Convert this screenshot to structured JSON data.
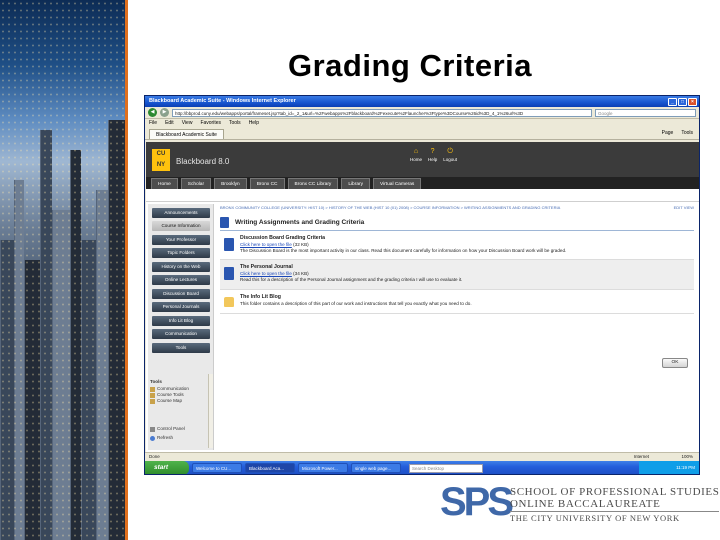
{
  "slide": {
    "title": "Grading Criteria",
    "accent_color": "#e0701e"
  },
  "browser": {
    "window_title": "Blackboard Academic Suite - Windows Internet Explorer",
    "url": "http://bbprod.cuny.edu/webapps/portal/frameset.jsp?tab_id=_2_1&url=%2Fwebapps%2Fblackboard%2Fexecute%2Flauncher%3Ftype%3DCourse%26id%3D_4_1%26url%3D",
    "search_placeholder": "Google",
    "menu": [
      "File",
      "Edit",
      "View",
      "Favorites",
      "Tools",
      "Help"
    ],
    "tab_label": "Blackboard Academic Suite",
    "toolbar_right": [
      "Page",
      "Tools"
    ],
    "status_left": "Done",
    "status_zone": "Internet",
    "status_zoom": "100%"
  },
  "bb": {
    "product": "Blackboard 8.0",
    "logo_text": "CU NY",
    "top_links": [
      {
        "label": "Home",
        "icon": "home-icon"
      },
      {
        "label": "Help",
        "icon": "help-icon"
      },
      {
        "label": "Logout",
        "icon": "logout-icon"
      }
    ],
    "tabs": [
      "Home",
      "Scholar",
      "Brooklyn",
      "Bronx CC",
      "Bronx CC Library",
      "Library",
      "Virtual Cameras"
    ],
    "sidebar": [
      "Announcements",
      "Course Information",
      "Your Professor",
      "Topic Folders",
      "History on the Web",
      "Online Lectures",
      "Discussion Board",
      "Personal Journals",
      "Info Lit Blog",
      "Communication",
      "Tools"
    ],
    "sidebar_selected": 1,
    "tools_panel": {
      "header": "Tools",
      "items": [
        "Communication",
        "Course Tools",
        "Course Map"
      ]
    },
    "control_panel": [
      "Control Panel",
      "Refresh"
    ],
    "breadcrumb": "BRONX COMMUNITY COLLEGE (UNIVERSITY: HIST 10) > HISTORY OF THE WEB (HIST 10 (01) 2008) > COURSE INFORMATION > WRITING ASSIGNMENTS AND GRADING CRITERIA",
    "edit_view": "EDIT VIEW",
    "page_title": "Writing Assignments and Grading Criteria",
    "items": [
      {
        "title": "Discussion Board Grading Criteria",
        "link": "Click here to open the file",
        "link_meta": "(32 KB)",
        "desc": "The Discussion Board is the most important activity in our class. Read this document carefully for information on how your Discussion Board work will be graded."
      },
      {
        "title": "The Personal Journal",
        "link": "Click here to open the file",
        "link_meta": "(34 KB)",
        "desc": "Read this for a description of the Personal Journal assignment and the grading criteria I will use to evaluate it."
      },
      {
        "title": "The Info Lit Blog",
        "link": "",
        "link_meta": "",
        "desc": "This folder contains a description of this part of our work and instructions that tell you exactly what you need to do."
      }
    ],
    "ok_label": "OK"
  },
  "taskbar": {
    "start": "start",
    "tasks": [
      "Welcome to CU...",
      "Blackboard Aca...",
      "Microsoft Power...",
      "single web page..."
    ],
    "search_placeholder": "Search Desktop",
    "clock": "11:19 PM"
  },
  "footer": {
    "mark": "SPS",
    "line1": "SCHOOL OF PROFESSIONAL STUDIES",
    "line2": "ONLINE BACCALAUREATE",
    "line3": "THE CITY UNIVERSITY OF NEW YORK",
    "brand_color": "#3f68a8"
  }
}
